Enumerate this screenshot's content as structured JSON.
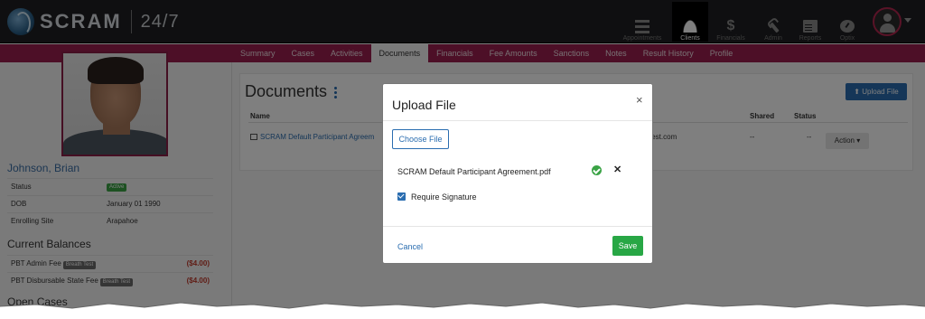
{
  "header": {
    "logo_text": "SCRAM",
    "logo_suffix": "24/7",
    "nav": [
      {
        "label": "Appointments",
        "icon": "list-icon"
      },
      {
        "label": "Clients",
        "icon": "users-icon",
        "active": true
      },
      {
        "label": "Financials",
        "icon": "dollar-icon"
      },
      {
        "label": "Admin",
        "icon": "wrench-icon"
      },
      {
        "label": "Reports",
        "icon": "document-icon"
      },
      {
        "label": "Optix",
        "icon": "gauge-icon"
      }
    ]
  },
  "tabs": [
    "Summary",
    "Cases",
    "Activities",
    "Documents",
    "Financials",
    "Fee Amounts",
    "Sanctions",
    "Notes",
    "Result History",
    "Profile"
  ],
  "active_tab": "Documents",
  "participant": {
    "name": "Johnson, Brian",
    "status_label": "Status",
    "status_value": "Active",
    "dob_label": "DOB",
    "dob_value": "January 01 1990",
    "site_label": "Enrolling Site",
    "site_value": "Arapahoe"
  },
  "balances": {
    "title": "Current Balances",
    "items": [
      {
        "name": "PBT Admin Fee",
        "tag": "Breath Test",
        "amount": "($4.00)"
      },
      {
        "name": "PBT Disbursable State Fee",
        "tag": "Breath Test",
        "amount": "($4.00)"
      }
    ]
  },
  "open_cases_title": "Open Cases",
  "documents": {
    "title": "Documents",
    "upload_label": "Upload File",
    "columns": {
      "name": "Name",
      "shared": "Shared",
      "status": "Status"
    },
    "rows": [
      {
        "name": "SCRAM Default Participant Agreem",
        "email_fragment": "test.com",
        "shared": "--",
        "status": "--",
        "action": "Action ▾"
      }
    ]
  },
  "modal": {
    "title": "Upload File",
    "close": "×",
    "choose_label": "Choose File",
    "file_name": "SCRAM Default Participant Agreement.pdf",
    "remove": "✕",
    "require_signature_label": "Require Signature",
    "require_signature_checked": true,
    "cancel_label": "Cancel",
    "save_label": "Save"
  },
  "colors": {
    "accent": "#9a1f4e",
    "primary": "#2a6db0",
    "success": "#28a745",
    "topbar": "#1e1f22"
  }
}
